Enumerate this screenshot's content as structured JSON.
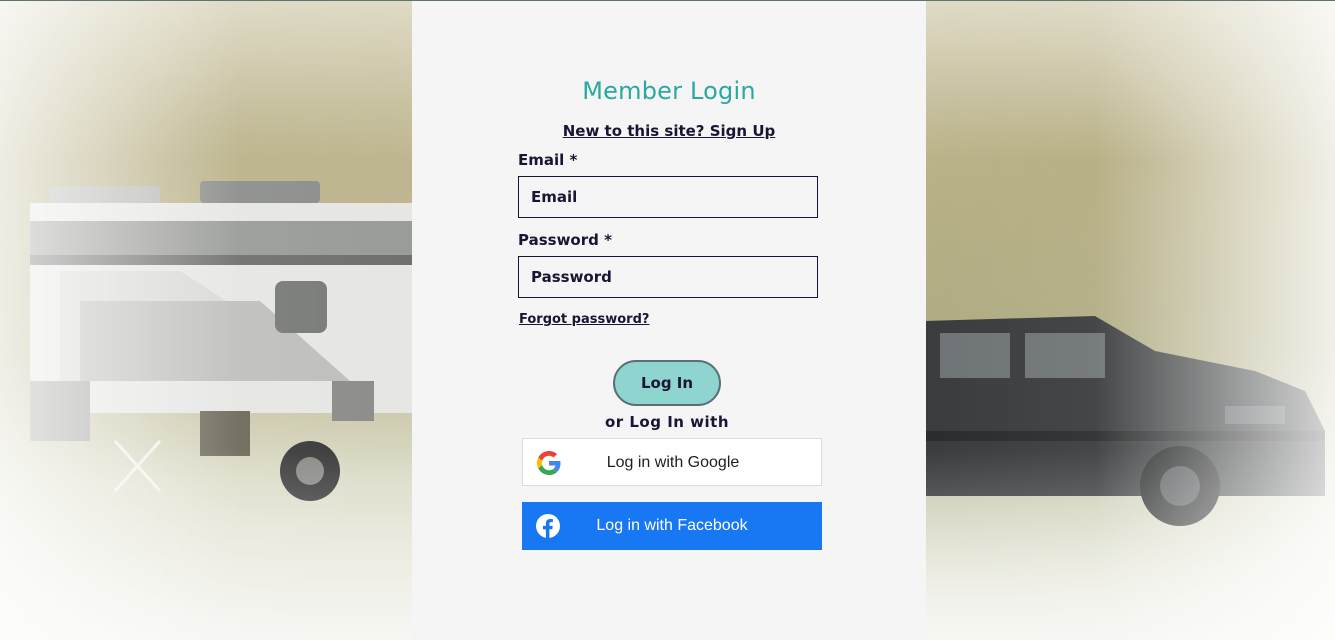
{
  "background": {
    "description_icon": "rv-and-truck-photo"
  },
  "colors": {
    "title": "#2aa9a0",
    "text": "#1a1533",
    "login_button": "#8fd5cf",
    "facebook": "#1877f2",
    "panel": "#f5f5f5"
  },
  "login": {
    "title": "Member Login",
    "signup_link": "New to this site? Sign Up",
    "email_label": "Email *",
    "email_placeholder": "Email",
    "password_label": "Password *",
    "password_placeholder": "Password",
    "forgot_link": "Forgot password?",
    "login_button": "Log In",
    "or_text": "or Log In with"
  },
  "social": {
    "google_label": "Log in with Google",
    "google_icon": "google-icon",
    "facebook_label": "Log in with Facebook",
    "facebook_icon": "facebook-icon"
  }
}
